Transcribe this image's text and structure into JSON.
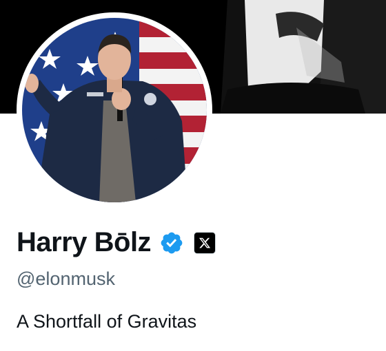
{
  "profile": {
    "display_name": "Harry Bōlz",
    "handle": "@elonmusk",
    "bio": "A Shortfall of Gravitas",
    "verified_icon": "verified-badge-icon",
    "affiliation_icon": "x-logo-icon"
  },
  "colors": {
    "verified_blue": "#1d9bf0",
    "name_text": "#0f1419",
    "handle_text": "#536471",
    "banner_bg": "#000000"
  }
}
